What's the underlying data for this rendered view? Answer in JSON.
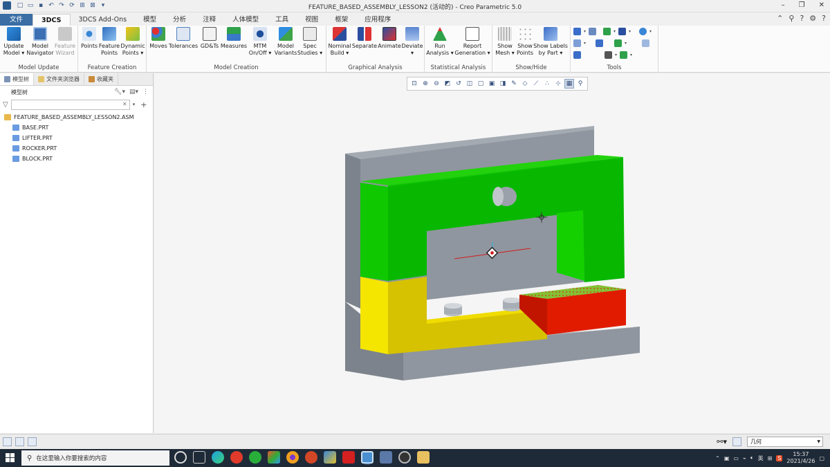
{
  "window": {
    "title": "FEATURE_BASED_ASSEMBLY_LESSON2 (活动的) - Creo Parametric 5.0"
  },
  "tabs": [
    {
      "label": "文件"
    },
    {
      "label": "3DCS"
    },
    {
      "label": "3DCS Add-Ons"
    },
    {
      "label": "模型"
    },
    {
      "label": "分析"
    },
    {
      "label": "注释"
    },
    {
      "label": "人体模型"
    },
    {
      "label": "工具"
    },
    {
      "label": "视图"
    },
    {
      "label": "框架"
    },
    {
      "label": "应用程序"
    }
  ],
  "ribbon": {
    "groups": [
      {
        "label": "Model Update"
      },
      {
        "label": "Feature Creation"
      },
      {
        "label": "Model Creation"
      },
      {
        "label": "Graphical Analysis"
      },
      {
        "label": "Statistical Analysis"
      },
      {
        "label": "Show/Hide"
      },
      {
        "label": "Tools"
      }
    ],
    "buttons": {
      "update_model": {
        "line1": "Update",
        "line2": "Model ▾"
      },
      "model_navigator": {
        "line1": "Model",
        "line2": "Navigator"
      },
      "feature_wizard": {
        "line1": "Feature",
        "line2": "Wizard"
      },
      "points": {
        "line1": "Points",
        "line2": ""
      },
      "feature_points": {
        "line1": "Feature",
        "line2": "Points"
      },
      "dynamic_points": {
        "line1": "Dynamic",
        "line2": "Points ▾"
      },
      "moves": {
        "line1": "Moves",
        "line2": ""
      },
      "tolerances": {
        "line1": "Tolerances",
        "line2": ""
      },
      "gdts": {
        "line1": "GD&Ts",
        "line2": ""
      },
      "measures": {
        "line1": "Measures",
        "line2": ""
      },
      "mtm": {
        "line1": "MTM",
        "line2": "On/Off ▾"
      },
      "model_variants": {
        "line1": "Model",
        "line2": "Variants"
      },
      "spec_studies": {
        "line1": "Spec",
        "line2": "Studies ▾"
      },
      "nominal_build": {
        "line1": "Nominal",
        "line2": "Build ▾"
      },
      "separate": {
        "line1": "Separate",
        "line2": ""
      },
      "animate": {
        "line1": "Animate",
        "line2": ""
      },
      "deviate": {
        "line1": "Deviate",
        "line2": "▾"
      },
      "run_analysis": {
        "line1": "Run",
        "line2": "Analysis ▾"
      },
      "report_generation": {
        "line1": "Report",
        "line2": "Generation ▾"
      },
      "show_mesh": {
        "line1": "Show",
        "line2": "Mesh ▾"
      },
      "show_points": {
        "line1": "Show",
        "line2": "Points"
      },
      "show_labels": {
        "line1": "Show Labels",
        "line2": "by Part ▾"
      }
    }
  },
  "panel": {
    "tabs": [
      {
        "label": "模型树"
      },
      {
        "label": "文件夹浏览器"
      },
      {
        "label": "收藏夹"
      }
    ],
    "title": "模型树",
    "search_placeholder": "",
    "tree": {
      "root": "FEATURE_BASED_ASSEMBLY_LESSON2.ASM",
      "children": [
        "BASE.PRT",
        "LIFTER.PRT",
        "ROCKER.PRT",
        "BLOCK.PRT"
      ]
    }
  },
  "statusbar": {
    "filter_value": "几何"
  },
  "taskbar": {
    "search_placeholder": "在这里输入你要搜索的内容",
    "tray_lang": "英",
    "time": "15:37",
    "date": "2021/4/26"
  },
  "colors": {
    "accent": "#3a6ea5",
    "base_gray": "#8f969f",
    "lifter_green": "#08b800",
    "rocker_yellow": "#f3dd00",
    "block_red": "#e01b00"
  }
}
